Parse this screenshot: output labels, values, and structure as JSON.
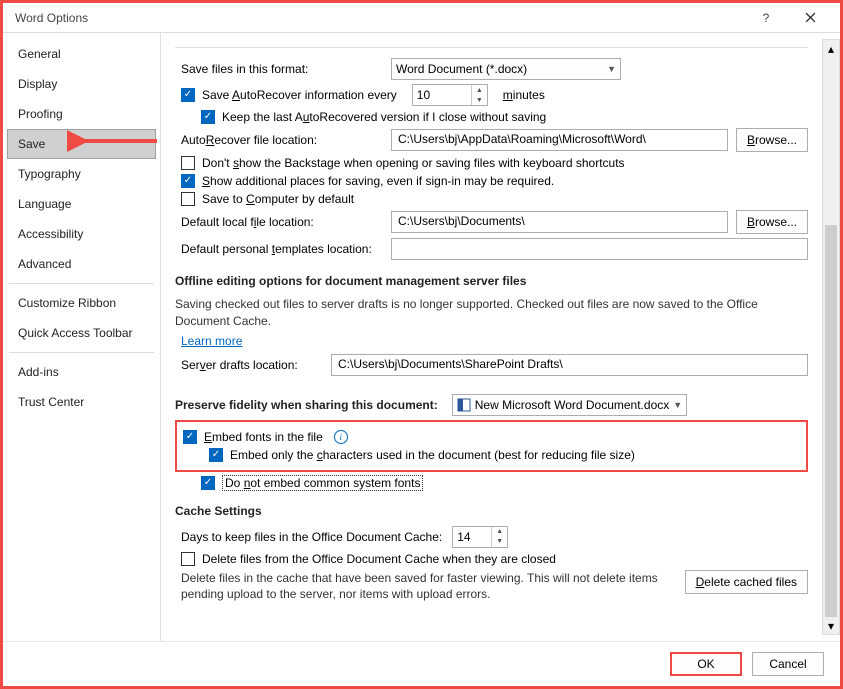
{
  "window": {
    "title": "Word Options"
  },
  "sidebar": {
    "items": [
      "General",
      "Display",
      "Proofing",
      "Save",
      "Typography",
      "Language",
      "Accessibility",
      "Advanced"
    ],
    "items2": [
      "Customize Ribbon",
      "Quick Access Toolbar"
    ],
    "items3": [
      "Add-ins",
      "Trust Center"
    ],
    "selected": "Save"
  },
  "save": {
    "format_label": "Save files in this format:",
    "format_value": "Word Document (*.docx)",
    "autorecover_label_pre": "Save ",
    "autorecover_label_mid": "AutoRecover information every",
    "autorecover_value": "10",
    "autorecover_label_post": "minutes",
    "keep_last_label": "Keep the last AutoRecovered version if I close without saving",
    "autorecover_loc_label": "AutoRecover file location:",
    "autorecover_loc_value": "C:\\Users\\bj\\AppData\\Roaming\\Microsoft\\Word\\",
    "browse": "Browse...",
    "dont_show_backstage": "Don't show the Backstage when opening or saving files with keyboard shortcuts",
    "show_additional": "Show additional places for saving, even if sign-in may be required.",
    "save_computer": "Save to Computer by default",
    "default_local_label": "Default local file location:",
    "default_local_value": "C:\\Users\\bj\\Documents\\",
    "default_tpl_label": "Default personal templates location:",
    "default_tpl_value": ""
  },
  "offline": {
    "head": "Offline editing options for document management server files",
    "desc": "Saving checked out files to server drafts is no longer supported. Checked out files are now saved to the Office Document Cache.",
    "learn_more": "Learn more",
    "drafts_label": "Server drafts location:",
    "drafts_value": "C:\\Users\\bj\\Documents\\SharePoint Drafts\\"
  },
  "fidelity": {
    "head": "Preserve fidelity when sharing this document:",
    "doc": "New Microsoft Word Document.docx",
    "embed": "Embed fonts in the file",
    "embed_only": "Embed only the characters used in the document (best for reducing file size)",
    "do_not_embed": "Do not embed common system fonts"
  },
  "cache": {
    "head": "Cache Settings",
    "days_label": "Days to keep files in the Office Document Cache:",
    "days_value": "14",
    "delete_closed": "Delete files from the Office Document Cache when they are closed",
    "delete_desc": "Delete files in the cache that have been saved for faster viewing. This will not delete items pending upload to the server, nor items with upload errors.",
    "delete_btn": "Delete cached files"
  },
  "footer": {
    "ok": "OK",
    "cancel": "Cancel"
  }
}
